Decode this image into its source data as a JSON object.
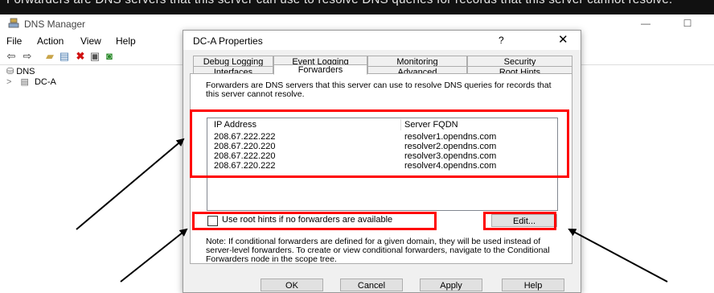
{
  "top_band_text": "Forwarders are DNS servers that this server can use to resolve DNS queries for records that this server cannot resolve.",
  "mmc": {
    "title": "DNS Manager",
    "menu": [
      "File",
      "Action",
      "View",
      "Help"
    ],
    "tree": {
      "root": "DNS",
      "child": "DC-A"
    }
  },
  "dialog": {
    "title": "DC-A Properties",
    "help_glyph": "?",
    "close_glyph": "✕",
    "tabs_top": [
      "Debug Logging",
      "Event Logging",
      "Monitoring",
      "Security"
    ],
    "tabs_bottom": [
      "Interfaces",
      "Forwarders",
      "Advanced",
      "Root Hints"
    ],
    "active_tab": "Forwarders",
    "description": "Forwarders are DNS servers that this server can use to resolve DNS queries for records that this server cannot resolve.",
    "columns": [
      "IP Address",
      "Server FQDN"
    ],
    "rows": [
      {
        "ip": "208.67.222.222",
        "fqdn": "resolver1.opendns.com"
      },
      {
        "ip": "208.67.220.220",
        "fqdn": "resolver2.opendns.com"
      },
      {
        "ip": "208.67.222.220",
        "fqdn": "resolver3.opendns.com"
      },
      {
        "ip": "208.67.220.222",
        "fqdn": "resolver4.opendns.com"
      }
    ],
    "checkbox_label": "Use root hints if no forwarders are available",
    "checkbox_checked": false,
    "edit_label": "Edit...",
    "note": "Note: If conditional forwarders are defined for a given domain, they will be used instead of server-level forwarders.  To create or view conditional forwarders, navigate to the Conditional Forwarders node in the scope tree.",
    "buttons": [
      "OK",
      "Cancel",
      "Apply",
      "Help"
    ]
  },
  "colors": {
    "highlight": "#ff0000",
    "dialog_bg": "#f0f0f0",
    "top_band": "#111111"
  }
}
